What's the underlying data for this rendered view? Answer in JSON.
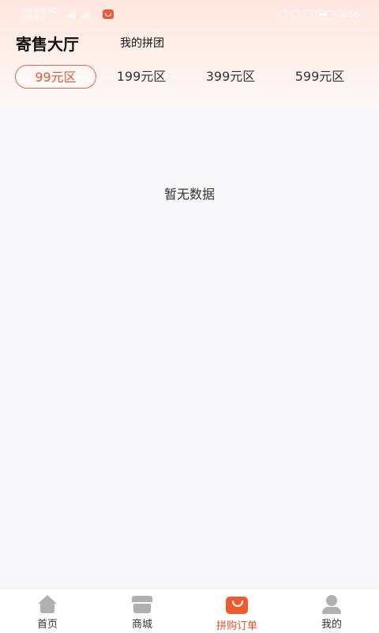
{
  "status_bar": {
    "carrier_line1": "中国联通 HD",
    "carrier_line2": "中国电信",
    "time": "3:56"
  },
  "header": {
    "title": "寄售大厅",
    "my_group": "我的拼团"
  },
  "tabs": [
    {
      "label": "99元区",
      "active": true
    },
    {
      "label": "199元区",
      "active": false
    },
    {
      "label": "399元区",
      "active": false
    },
    {
      "label": "599元区",
      "active": false
    }
  ],
  "empty_text": "暂无数据",
  "bottom_nav": [
    {
      "label": "首页",
      "icon": "home-icon",
      "active": false
    },
    {
      "label": "商城",
      "icon": "mall-icon",
      "active": false
    },
    {
      "label": "拼购订单",
      "icon": "shopping-bag-icon",
      "active": true
    },
    {
      "label": "我的",
      "icon": "user-icon",
      "active": false
    }
  ],
  "colors": {
    "accent": "#e8512e",
    "tab_border": "#e2674a",
    "header_bg": "#ffe6df"
  }
}
